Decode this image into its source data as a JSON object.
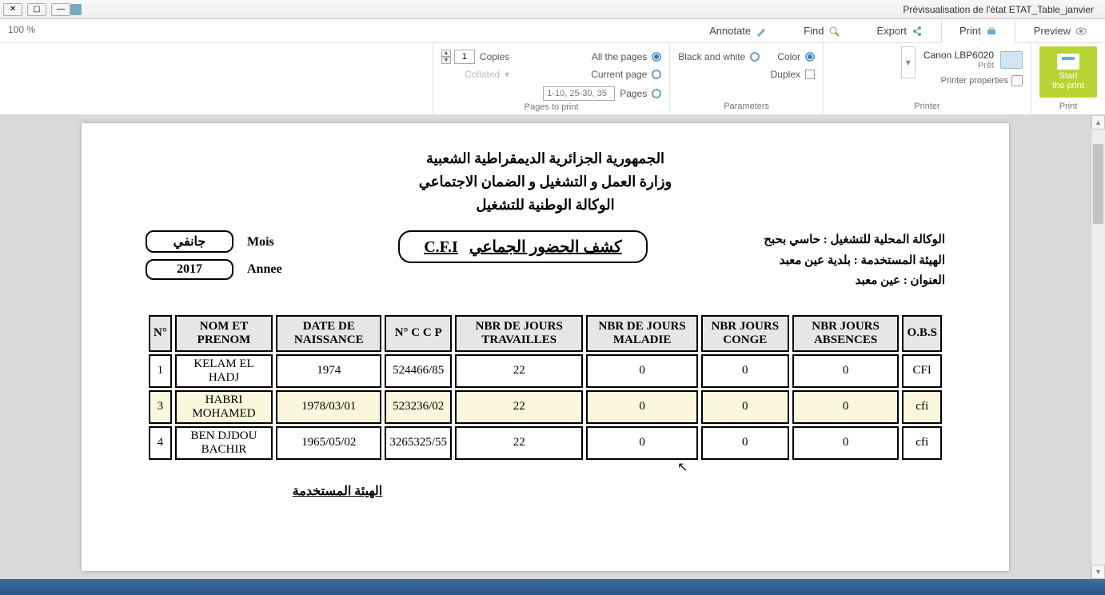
{
  "window": {
    "title": "Prévisualisation de l'état ETAT_Table_janvier"
  },
  "zoom": "100 %",
  "tabs": {
    "annotate": "Annotate",
    "find": "Find",
    "export": "Export",
    "print": "Print",
    "preview": "Preview"
  },
  "ribbon": {
    "start_print": "Start\nthe print",
    "group_print": "Print",
    "printer_name": "Canon LBP6020",
    "printer_status": "Prêt",
    "printer_props": "Printer properties",
    "group_printer": "Printer",
    "bw": "Black and white",
    "color": "Color",
    "duplex": "Duplex",
    "group_params": "Parameters",
    "copies_val": "1",
    "copies_lbl": "Copies",
    "collated": "Collated",
    "all_pages": "All the pages",
    "current_page": "Current page",
    "pages_lbl": "Pages",
    "pages_ph": "1-10, 25-30, 35",
    "group_pages": "Pages to print"
  },
  "doc": {
    "h1": "الجمهورية الجزائرية الديمقراطية الشعبية",
    "h2": "وزارة العمل و التشغيل و الضمان الاجتماعي",
    "h3": "الوكالة الوطنية للتشغيل",
    "mois_val": "جانفي",
    "mois_lbl": "Mois",
    "annee_val": "2017",
    "annee_lbl": "Annee",
    "title_ar": "كشف الحضور الجماعي",
    "title_fr": "C.F.I",
    "r1": "الوكالة المحلية للتشغيل : حاسي بحبح",
    "r2": "الهيئة المستخدمة : بلدية عين معبد",
    "r3": "العنوان : عين معبد",
    "cols": [
      "N°",
      "NOM ET PRENOM",
      "DATE DE NAISSANCE",
      "N° C C P",
      "NBR DE JOURS TRAVAILLES",
      "NBR DE JOURS MALADIE",
      "NBR JOURS CONGE",
      "NBR JOURS ABSENCES",
      "O.B.S"
    ],
    "rows": [
      {
        "n": "1",
        "nom": "KELAM EL HADJ",
        "dn": "1974",
        "ccp": "524466/85",
        "jt": "22",
        "jm": "0",
        "jc": "0",
        "ja": "0",
        "obs": "CFI",
        "hl": false
      },
      {
        "n": "3",
        "nom": "HABRI MOHAMED",
        "dn": "1978/03/01",
        "ccp": "523236/02",
        "jt": "22",
        "jm": "0",
        "jc": "0",
        "ja": "0",
        "obs": "cfi",
        "hl": true
      },
      {
        "n": "4",
        "nom": "BEN DJDOU BACHIR",
        "dn": "1965/05/02",
        "ccp": "3265325/55",
        "jt": "22",
        "jm": "0",
        "jc": "0",
        "ja": "0",
        "obs": "cfi",
        "hl": false
      }
    ],
    "footer": "الهيئة المستخدمة"
  }
}
